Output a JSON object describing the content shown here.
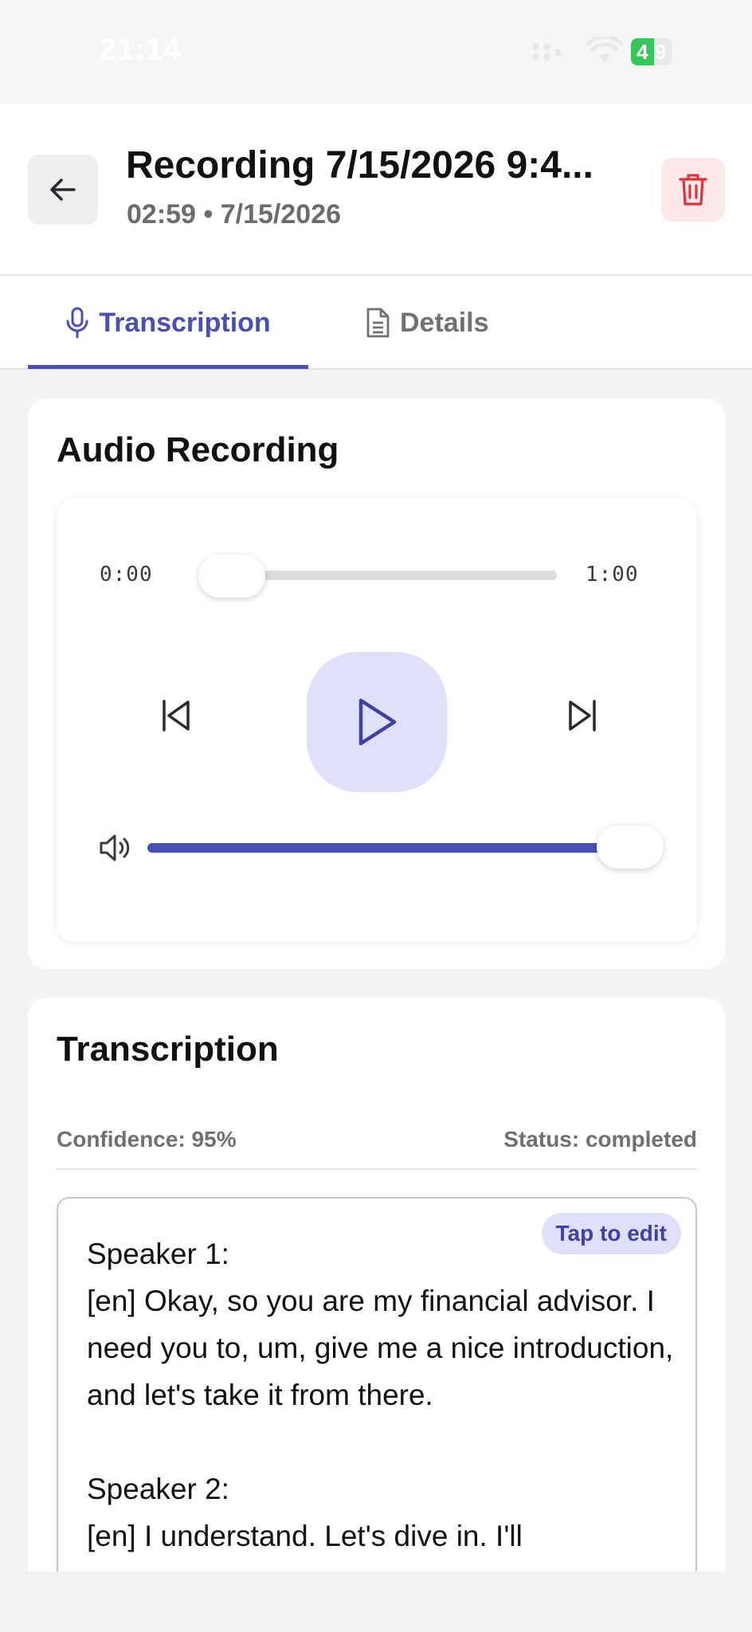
{
  "status_bar": {
    "time": "21:14",
    "battery": "4",
    "battery_rest": "9"
  },
  "header": {
    "title": "Recording 7/15/2026 9:4...",
    "subtitle": "02:59 • 7/15/2026",
    "back_icon": "arrow-left-icon",
    "delete_icon": "trash-icon"
  },
  "tabs": [
    {
      "label": "Transcription",
      "icon": "microphone-icon",
      "active": true
    },
    {
      "label": "Details",
      "icon": "document-icon",
      "active": false
    }
  ],
  "audio": {
    "title": "Audio Recording",
    "current_time": "0:00",
    "duration": "1:00",
    "progress": 0,
    "volume": 1.0
  },
  "transcription": {
    "title": "Transcription",
    "confidence": "Confidence: 95%",
    "status": "Status: completed",
    "edit_label": "Tap to edit",
    "text": "Speaker 1:\n[en] Okay, so you are my financial advisor. I need you to, um, give me a nice introduction, and let's take it from there.\n\nSpeaker 2:\n[en] I understand. Let's dive in. I'll"
  },
  "colors": {
    "accent": "#4a4eb7",
    "accent_soft": "#e0e0fb",
    "danger": "#e0323a",
    "danger_soft": "#fde9ea"
  }
}
